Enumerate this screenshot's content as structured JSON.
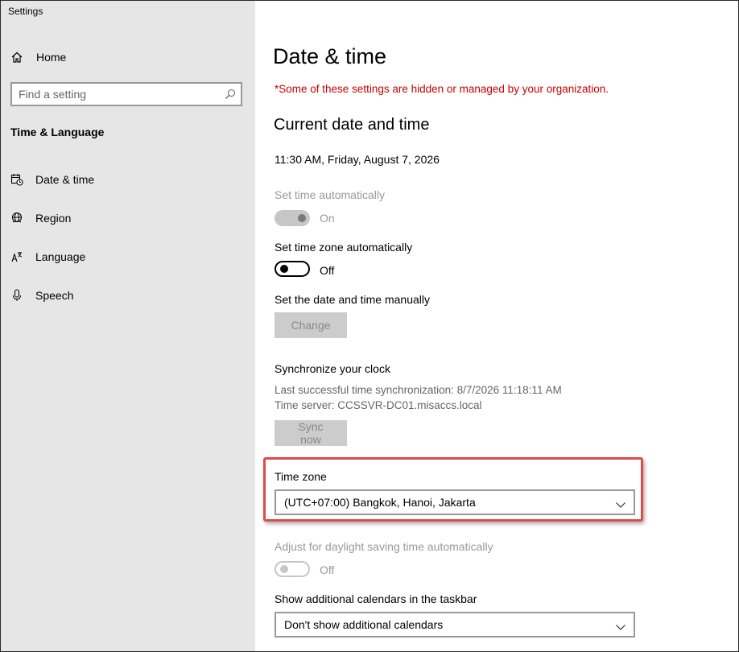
{
  "app": {
    "title": "Settings"
  },
  "sidebar": {
    "home_label": "Home",
    "search_placeholder": "Find a setting",
    "section_title": "Time & Language",
    "items": [
      {
        "label": "Date & time",
        "icon": "calendar-clock-icon"
      },
      {
        "label": "Region",
        "icon": "globe-icon"
      },
      {
        "label": "Language",
        "icon": "language-icon"
      },
      {
        "label": "Speech",
        "icon": "microphone-icon"
      }
    ]
  },
  "main": {
    "title": "Date & time",
    "org_warning": "*Some of these settings are hidden or managed by your organization.",
    "current_heading": "Current date and time",
    "current_datetime": "11:30 AM, Friday, August 7, 2026",
    "set_time_auto": {
      "label": "Set time automatically",
      "state": "On",
      "enabled": false
    },
    "set_tz_auto": {
      "label": "Set time zone automatically",
      "state": "Off",
      "enabled": true
    },
    "manual": {
      "label": "Set the date and time manually",
      "button": "Change"
    },
    "sync": {
      "heading": "Synchronize your clock",
      "last_sync": "Last successful time synchronization: 8/7/2026 11:18:11 AM",
      "server": "Time server: CCSSVR-DC01.misaccs.local",
      "button": "Sync now"
    },
    "time_zone": {
      "label": "Time zone",
      "value": "(UTC+07:00) Bangkok, Hanoi, Jakarta"
    },
    "dst": {
      "label": "Adjust for daylight saving time automatically",
      "state": "Off",
      "enabled": false
    },
    "calendars": {
      "label": "Show additional calendars in the taskbar",
      "value": "Don't show additional calendars"
    }
  },
  "colors": {
    "warning": "#c80000",
    "highlight": "#e04a4a",
    "sidebar_bg": "#e6e6e6"
  }
}
